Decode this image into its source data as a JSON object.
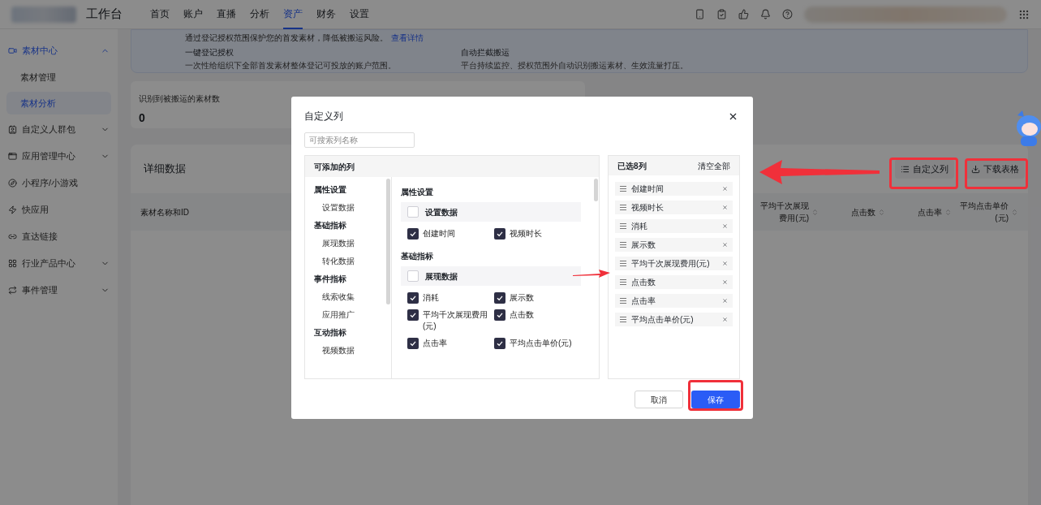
{
  "nav": {
    "brand": "工作台",
    "tabs": [
      {
        "label": "首页",
        "selected": false
      },
      {
        "label": "账户",
        "selected": false
      },
      {
        "label": "直播",
        "selected": false
      },
      {
        "label": "分析",
        "selected": false
      },
      {
        "label": "资产",
        "selected": true
      },
      {
        "label": "财务",
        "selected": false
      },
      {
        "label": "设置",
        "selected": false
      }
    ]
  },
  "sidebar": {
    "items": [
      {
        "label": "素材中心",
        "kind": "group",
        "expanded": true,
        "children": [
          {
            "label": "素材管理",
            "selected": false
          },
          {
            "label": "素材分析",
            "selected": true
          }
        ]
      },
      {
        "label": "自定义人群包",
        "kind": "group",
        "expanded": false
      },
      {
        "label": "应用管理中心",
        "kind": "group",
        "expanded": false
      },
      {
        "label": "小程序/小游戏",
        "kind": "link"
      },
      {
        "label": "快应用",
        "kind": "link"
      },
      {
        "label": "直达链接",
        "kind": "link"
      },
      {
        "label": "行业产品中心",
        "kind": "group",
        "expanded": false
      },
      {
        "label": "事件管理",
        "kind": "group",
        "expanded": false
      }
    ]
  },
  "banner": {
    "intro": "通过登记授权范围保护您的首发素材，降低被搬运风险。",
    "link": "查看详情",
    "features": [
      {
        "title": "一键登记授权",
        "desc": "一次性给组织下全部首发素材整体登记可投放的账户范围。"
      },
      {
        "title": "自动拦截搬运",
        "desc": "平台持续监控、授权范围外自动识别搬运素材、生效流量打压。"
      }
    ]
  },
  "stats": [
    {
      "label": "识别到被搬运的素材数",
      "value": "0"
    }
  ],
  "details": {
    "title": "详细数据",
    "buttons": [
      "自定义列",
      "下载表格"
    ],
    "columns": [
      {
        "label": "素材名称和ID",
        "sortable": false
      },
      {
        "label": "平均千次展现费用(元)",
        "sortable": true
      },
      {
        "label": "点击数",
        "sortable": true
      },
      {
        "label": "点击率",
        "sortable": true
      },
      {
        "label": "平均点击单价(元)",
        "sortable": true
      }
    ]
  },
  "dialog": {
    "title": "自定义列",
    "search": {
      "placeholder": "可搜索列名称"
    },
    "available": {
      "header": "可添加的列",
      "nav": [
        {
          "label": "属性设置",
          "children": [
            {
              "label": "设置数据"
            }
          ]
        },
        {
          "label": "基础指标",
          "children": [
            {
              "label": "展现数据"
            },
            {
              "label": "转化数据"
            }
          ]
        },
        {
          "label": "事件指标",
          "children": [
            {
              "label": "线索收集"
            },
            {
              "label": "应用推广"
            }
          ]
        },
        {
          "label": "互动指标",
          "children": [
            {
              "label": "视频数据"
            }
          ]
        }
      ],
      "sections": [
        {
          "title": "属性设置",
          "groups": [
            {
              "label": "设置数据",
              "checked": false,
              "items": [
                {
                  "label": "创建时间",
                  "checked": true
                },
                {
                  "label": "视频时长",
                  "checked": true
                }
              ]
            }
          ]
        },
        {
          "title": "基础指标",
          "groups": [
            {
              "label": "展现数据",
              "checked": false,
              "items": [
                {
                  "label": "消耗",
                  "checked": true
                },
                {
                  "label": "展示数",
                  "checked": true
                },
                {
                  "label": "平均千次展现费用(元)",
                  "checked": true
                },
                {
                  "label": "点击数",
                  "checked": true
                },
                {
                  "label": "点击率",
                  "checked": true
                },
                {
                  "label": "平均点击单价(元)",
                  "checked": true
                }
              ]
            }
          ]
        }
      ]
    },
    "selected": {
      "header": "已选8列",
      "clear": "清空全部",
      "items": [
        "创建时间",
        "视频时长",
        "消耗",
        "展示数",
        "平均千次展现费用(元)",
        "点击数",
        "点击率",
        "平均点击单价(元)"
      ]
    },
    "buttons": [
      {
        "label": "取消",
        "kind": "secondary"
      },
      {
        "label": "保存",
        "kind": "primary"
      }
    ]
  }
}
